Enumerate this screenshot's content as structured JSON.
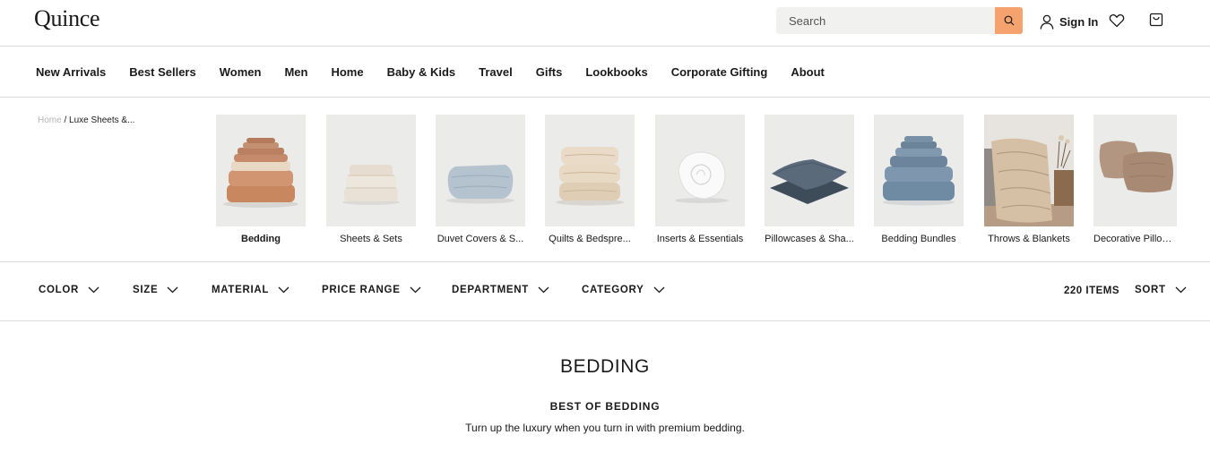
{
  "header": {
    "logo": "Quince",
    "search_placeholder": "Search",
    "signin_label": "Sign In"
  },
  "nav": {
    "items": [
      "New Arrivals",
      "Best Sellers",
      "Women",
      "Men",
      "Home",
      "Baby & Kids",
      "Travel",
      "Gifts",
      "Lookbooks",
      "Corporate Gifting",
      "About"
    ]
  },
  "breadcrumb": {
    "home": "Home",
    "separator": "/",
    "current": "Luxe Sheets &..."
  },
  "categories": [
    {
      "label": "Bedding",
      "icon": "folded-bedding-stack-image",
      "active": true
    },
    {
      "label": "Sheets & Sets",
      "icon": "folded-sheets-image"
    },
    {
      "label": "Duvet Covers & S...",
      "icon": "duvet-cover-image"
    },
    {
      "label": "Quilts & Bedspre...",
      "icon": "quilts-image"
    },
    {
      "label": "Inserts & Essentials",
      "icon": "rolled-insert-image"
    },
    {
      "label": "Pillowcases & Sha...",
      "icon": "pillowcases-image"
    },
    {
      "label": "Bedding Bundles",
      "icon": "bedding-bundle-image"
    },
    {
      "label": "Throws & Blankets",
      "icon": "throw-blanket-image"
    },
    {
      "label": "Decorative Pillow ...",
      "icon": "decorative-pillow-image"
    }
  ],
  "filters": [
    "COLOR",
    "SIZE",
    "MATERIAL",
    "PRICE RANGE",
    "DEPARTMENT",
    "CATEGORY"
  ],
  "items_count": "220 ITEMS",
  "sort_label": "SORT",
  "page": {
    "title": "BEDDING",
    "subtitle": "BEST OF BEDDING",
    "description": "Turn up the luxury when you turn in with premium bedding."
  },
  "colors": {
    "search_button": "#f5a26e",
    "tile_background": "#ebebea",
    "divider": "#dcdcdc"
  }
}
